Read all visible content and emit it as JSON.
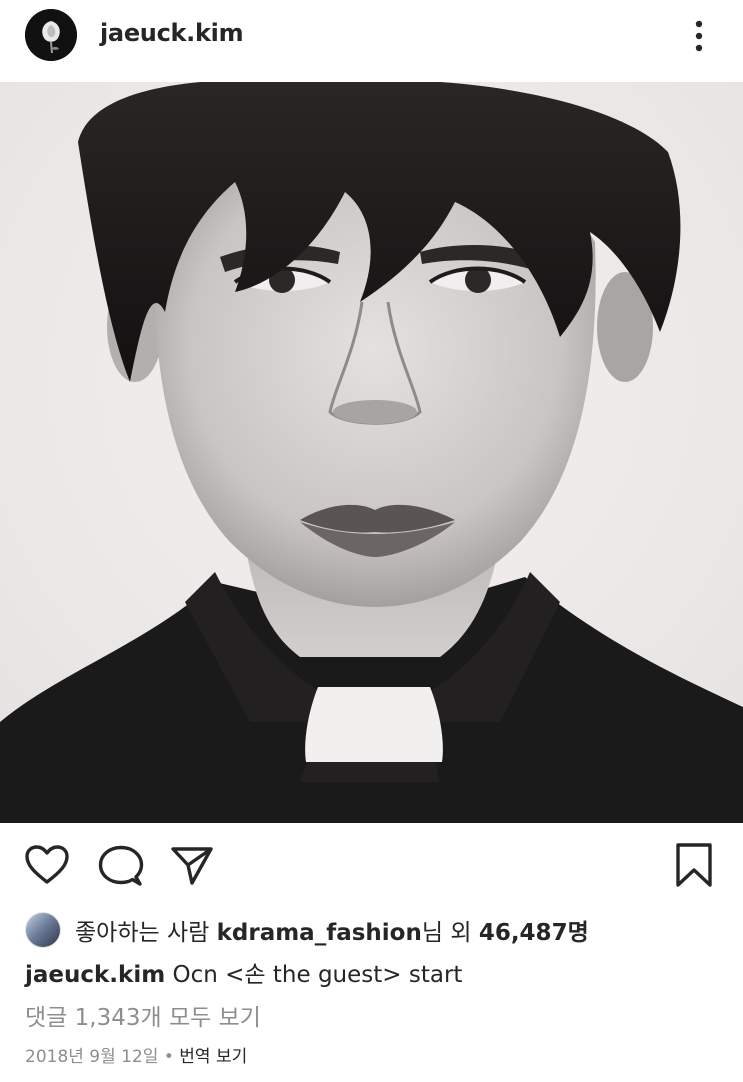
{
  "header": {
    "username": "jaeuck.kim",
    "avatar_icon": "rose-avatar-icon",
    "more_icon": "more-vertical-icon"
  },
  "post": {
    "photo_description_icon": "post-photo"
  },
  "actions": {
    "like_icon": "heart-icon",
    "comment_icon": "comment-icon",
    "share_icon": "send-icon",
    "save_icon": "bookmark-icon"
  },
  "likes": {
    "prefix": "좋아하는 사람 ",
    "user": "kdrama_fashion",
    "suffix_mid": "님 외 ",
    "count": "46,487명"
  },
  "caption": {
    "username": "jaeuck.kim",
    "text": " Ocn <손 the guest> start"
  },
  "comments": {
    "view_all": "댓글 1,343개 모두 보기"
  },
  "meta": {
    "date": "2018년 9월 12일",
    "separator": " • ",
    "translate": "번역 보기"
  },
  "colors": {
    "text": "#262626",
    "secondary": "#8e8e8e",
    "background": "#ffffff"
  }
}
